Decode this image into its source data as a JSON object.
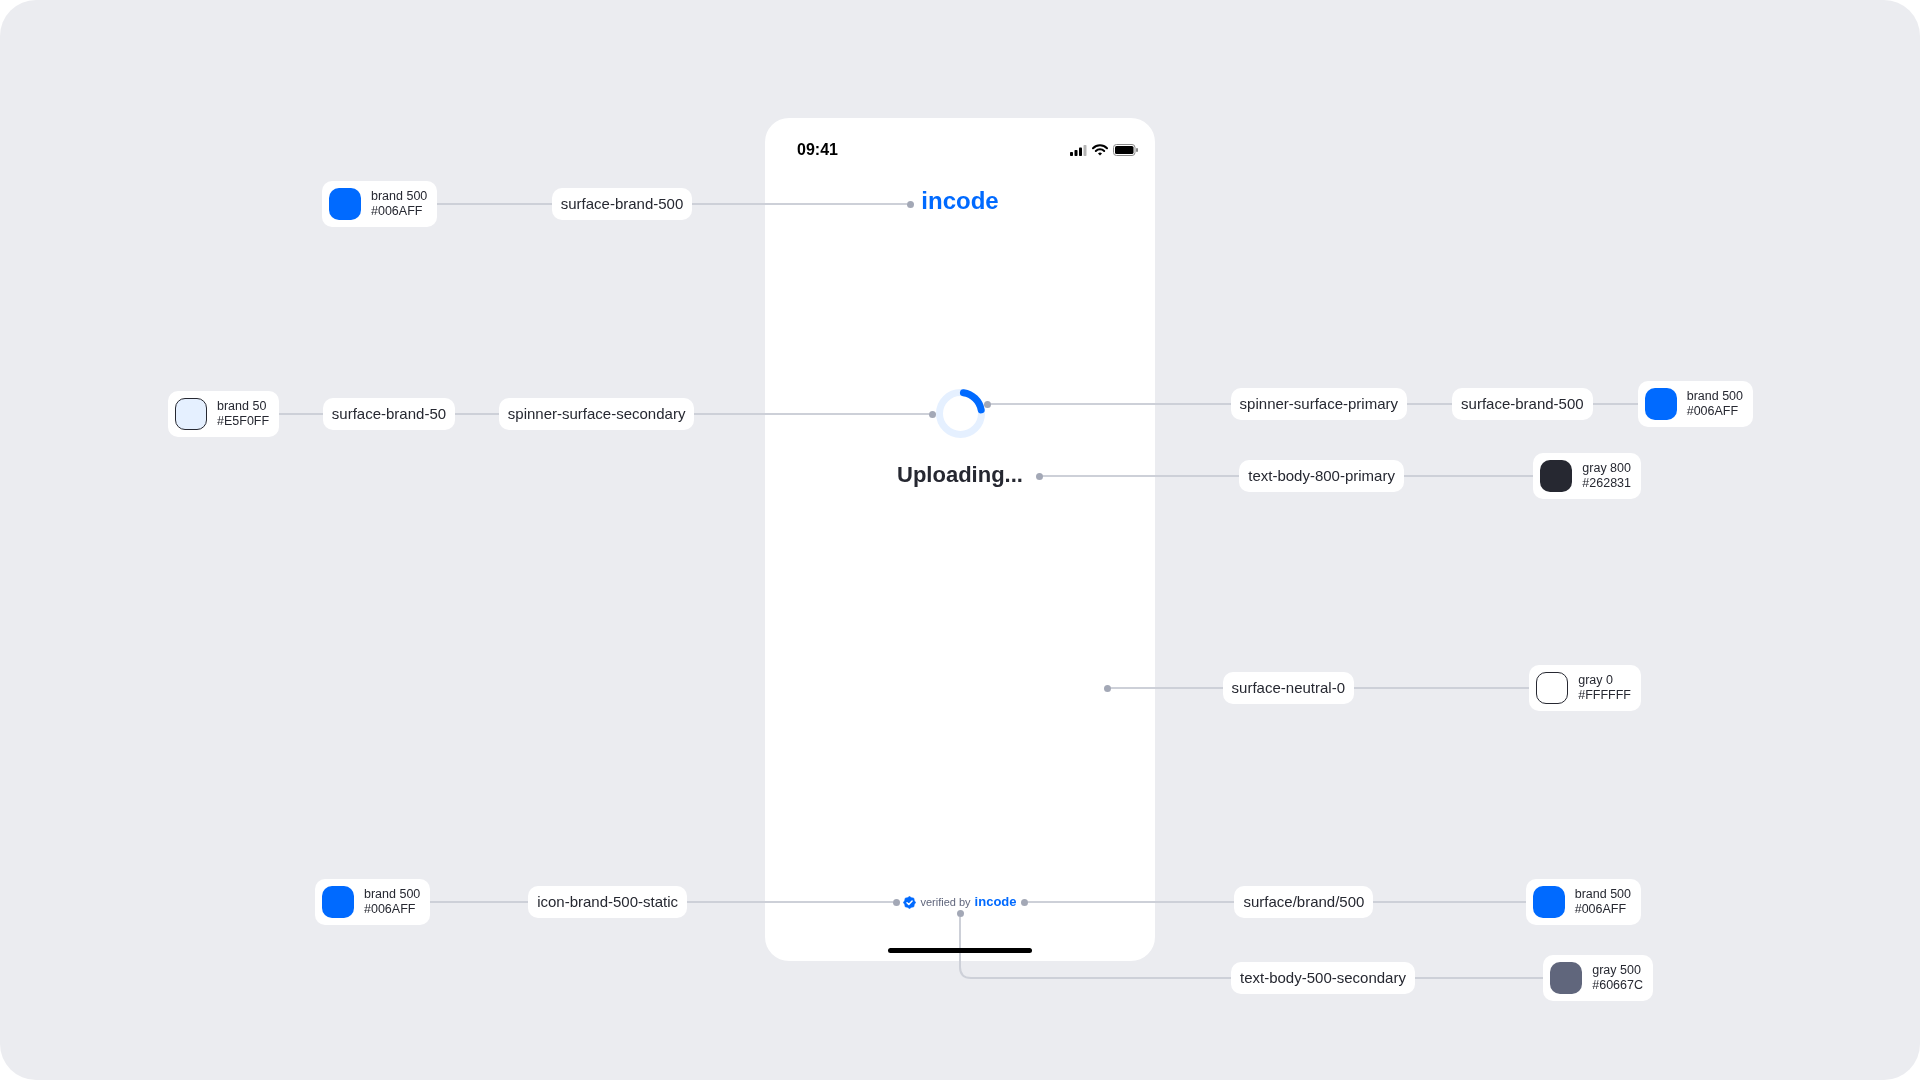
{
  "phone": {
    "status_bar": {
      "time": "09:41"
    },
    "logo": "incode",
    "status_text": "Uploading...",
    "footer": {
      "prefix": "verified by",
      "brand": "incode"
    }
  },
  "annotations": [
    {
      "items": [
        {
          "kind": "swatch",
          "name": "brand 500",
          "hex": "#006AFF",
          "color": "#006aff"
        },
        {
          "kind": "token",
          "label": "surface-brand-500"
        }
      ]
    },
    {
      "items": [
        {
          "kind": "swatch",
          "name": "brand 50",
          "hex": "#E5F0FF",
          "color": "#e5f0ff"
        },
        {
          "kind": "token",
          "label": "surface-brand-50"
        },
        {
          "kind": "token",
          "label": "spinner-surface-secondary"
        }
      ]
    },
    {
      "items": [
        {
          "kind": "token",
          "label": "spinner-surface-primary"
        },
        {
          "kind": "token",
          "label": "surface-brand-500"
        },
        {
          "kind": "swatch",
          "name": "brand 500",
          "hex": "#006AFF",
          "color": "#006aff"
        }
      ]
    },
    {
      "items": [
        {
          "kind": "token",
          "label": "text-body-800-primary"
        },
        {
          "kind": "swatch",
          "name": "gray 800",
          "hex": "#262831",
          "color": "#262831"
        }
      ]
    },
    {
      "items": [
        {
          "kind": "token",
          "label": "surface-neutral-0"
        },
        {
          "kind": "swatch",
          "name": "gray 0",
          "hex": "#FFFFFF",
          "color": "#ffffff"
        }
      ]
    },
    {
      "items": [
        {
          "kind": "swatch",
          "name": "brand 500",
          "hex": "#006AFF",
          "color": "#006aff"
        },
        {
          "kind": "token",
          "label": "icon-brand-500-static"
        }
      ]
    },
    {
      "items": [
        {
          "kind": "token",
          "label": "surface/brand/500"
        },
        {
          "kind": "swatch",
          "name": "brand 500",
          "hex": "#006AFF",
          "color": "#006aff"
        }
      ]
    },
    {
      "items": [
        {
          "kind": "token",
          "label": "text-body-500-secondary"
        },
        {
          "kind": "swatch",
          "name": "gray 500",
          "hex": "#60667C",
          "color": "#60667c"
        }
      ]
    }
  ]
}
